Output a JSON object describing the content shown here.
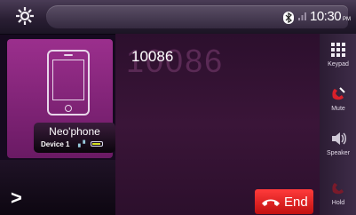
{
  "status": {
    "time": "10:30",
    "ampm": "PM"
  },
  "device": {
    "name": "Neo'phone",
    "label": "Device 1"
  },
  "call": {
    "number": "10086",
    "background_digits": "10086"
  },
  "sidebar": [
    {
      "label": "Keypad",
      "icon": "keypad-icon"
    },
    {
      "label": "Mute",
      "icon": "mute-icon"
    },
    {
      "label": "Speaker",
      "icon": "speaker-icon"
    },
    {
      "label": "Hold",
      "icon": "hold-icon"
    }
  ],
  "end_button": {
    "label": "End",
    "color": "#e01a1a"
  },
  "colors": {
    "accent": "#8e2a86",
    "background": "#160a1f"
  }
}
